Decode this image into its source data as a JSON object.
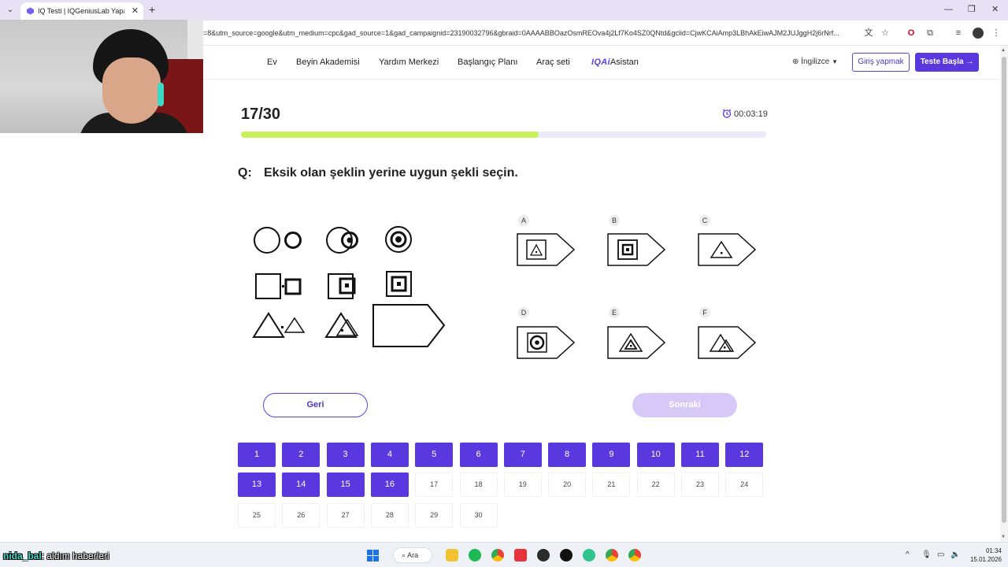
{
  "browser": {
    "tab_title": "IQ Testi | IQGeniusLab Yapay Ze",
    "new_tab_glyph": "+",
    "close_glyph": "✕",
    "url": "=8&utm_source=google&utm_medium=cpc&gad_source=1&gad_campaignid=23190032796&gbraid=0AAAABBOazOsmREOva4j2Lf7Ko4SZ0QNtd&gclid=CjwKCAiAmp3LBhAkEiwAJM2JUJggH2j6rNrf...",
    "icons": [
      "translate-icon",
      "bookmark-star-icon",
      "opera-icon",
      "extensions-icon",
      "media-icon",
      "profile-icon",
      "menu-icon"
    ]
  },
  "nav": {
    "items": [
      "Ev",
      "Beyin Akademisi",
      "Yardım Merkezi",
      "Başlangıç Planı",
      "Araç seti"
    ],
    "brand": "IQAi",
    "assistant": "Asistan",
    "language": "İngilizce",
    "login": "Giriş yapmak",
    "start": "Teste Başla",
    "start_arrow": "→"
  },
  "quiz": {
    "counter": "17/30",
    "timer": "00:03:19",
    "progress_fraction": 0.567,
    "question_prefix": "Q:",
    "question": "Eksik olan şeklin yerine uygun şekli seçin.",
    "options": [
      "A",
      "B",
      "C",
      "D",
      "E",
      "F"
    ],
    "back": "Geri",
    "next": "Sonraki",
    "questions_row1": [
      "1",
      "2",
      "3",
      "4",
      "5",
      "6",
      "7",
      "8",
      "9",
      "10",
      "11",
      "12"
    ],
    "questions_row2": [
      "13",
      "14",
      "15",
      "16",
      "17",
      "18",
      "19",
      "20",
      "21",
      "22",
      "23",
      "24"
    ],
    "questions_row3": [
      "25",
      "26",
      "27",
      "28",
      "29",
      "30"
    ],
    "answered_count": 16
  },
  "colors": {
    "primary": "#5a38e0",
    "progress": "#c7f05a",
    "next_disabled": "#d6c8f7"
  },
  "taskbar": {
    "chat_user": "nida_bal",
    "chat_message": ": aldım haberleri",
    "search": "Ara",
    "time": "01:34",
    "date": "15.01.2026"
  }
}
